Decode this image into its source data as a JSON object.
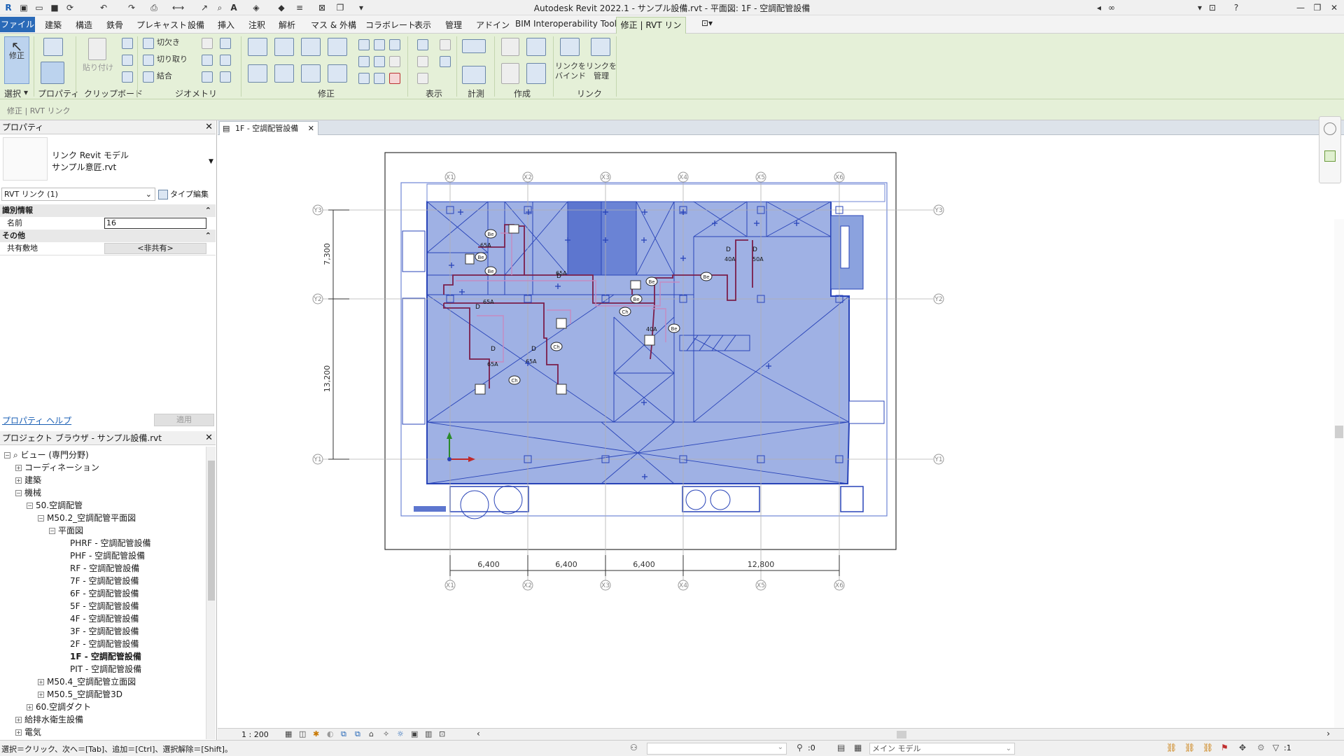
{
  "app": {
    "title": "Autodesk Revit 2022.1 - サンプル設備.rvt - 平面図: 1F - 空調配管設備"
  },
  "ribbon": {
    "file_tab": "ファイル",
    "tabs": [
      "建築",
      "構造",
      "鉄骨",
      "プレキャスト",
      "設備",
      "挿入",
      "注釈",
      "解析",
      "マス & 外構",
      "コラボレート",
      "表示",
      "管理",
      "アドイン",
      "BIM Interoperability Tools"
    ],
    "active_tab": "修正 | RVT リンク",
    "modify_label": "修正",
    "paste_label": "貼り付け",
    "cut_label": "切欠き",
    "split_label": "切り取り",
    "join_label": "結合",
    "properties_label": "プロパティ",
    "bind_link_label": "リンクを バインド",
    "manage_link_label": "リンクを 管理",
    "panels": {
      "select": "選択",
      "properties": "プロパティ",
      "clipboard": "クリップボード",
      "geometry": "ジオメトリ",
      "modify": "修正",
      "view": "表示",
      "measure": "計測",
      "create": "作成",
      "link": "リンク"
    }
  },
  "options_bar": {
    "context": "修正 | RVT リンク"
  },
  "properties": {
    "title": "プロパティ",
    "type_line1": "リンク Revit モデル",
    "type_line2": "サンプル意匠.rvt",
    "selector": "RVT リンク (1)",
    "edit_type": "タイプ編集",
    "group_identity": "識別情報",
    "name_label": "名前",
    "name_value": "16",
    "group_other": "その他",
    "shared_site_label": "共有敷地",
    "shared_site_value": "<非共有>",
    "help_link": "プロパティ ヘルプ",
    "apply": "適用"
  },
  "browser": {
    "title": "プロジェクト ブラウザ - サンプル設備.rvt",
    "items": [
      {
        "label": "ビュー (専門分野)",
        "depth": 0,
        "toggle": "−",
        "icon": true
      },
      {
        "label": "コーディネーション",
        "depth": 1,
        "toggle": "+"
      },
      {
        "label": "建築",
        "depth": 1,
        "toggle": "+"
      },
      {
        "label": "機械",
        "depth": 1,
        "toggle": "−"
      },
      {
        "label": "50.空調配管",
        "depth": 2,
        "toggle": "−"
      },
      {
        "label": "M50.2_空調配管平面図",
        "depth": 3,
        "toggle": "−"
      },
      {
        "label": "平面図",
        "depth": 4,
        "toggle": "−"
      },
      {
        "label": "PHRF - 空調配管設備",
        "depth": 5,
        "toggle": ""
      },
      {
        "label": "PHF - 空調配管設備",
        "depth": 5,
        "toggle": ""
      },
      {
        "label": "RF - 空調配管設備",
        "depth": 5,
        "toggle": ""
      },
      {
        "label": "7F - 空調配管設備",
        "depth": 5,
        "toggle": ""
      },
      {
        "label": "6F - 空調配管設備",
        "depth": 5,
        "toggle": ""
      },
      {
        "label": "5F - 空調配管設備",
        "depth": 5,
        "toggle": ""
      },
      {
        "label": "4F - 空調配管設備",
        "depth": 5,
        "toggle": ""
      },
      {
        "label": "3F - 空調配管設備",
        "depth": 5,
        "toggle": ""
      },
      {
        "label": "2F - 空調配管設備",
        "depth": 5,
        "toggle": ""
      },
      {
        "label": "1F - 空調配管設備",
        "depth": 5,
        "toggle": "",
        "bold": true
      },
      {
        "label": "PIT - 空調配管設備",
        "depth": 5,
        "toggle": ""
      },
      {
        "label": "M50.4_空調配管立面図",
        "depth": 3,
        "toggle": "+"
      },
      {
        "label": "M50.5_空調配管3D",
        "depth": 3,
        "toggle": "+"
      },
      {
        "label": "60.空調ダクト",
        "depth": 2,
        "toggle": "+"
      },
      {
        "label": "給排水衛生設備",
        "depth": 1,
        "toggle": "+"
      },
      {
        "label": "電気",
        "depth": 1,
        "toggle": "+"
      }
    ]
  },
  "view": {
    "tab_label": "1F - 空調配管設備",
    "scale": "1 : 200",
    "grids_x": [
      "X1",
      "X2",
      "X3",
      "X4",
      "X5",
      "X6"
    ],
    "grids_y": [
      "Y3",
      "Y2",
      "Y1"
    ],
    "dims_bottom": [
      "6,400",
      "6,400",
      "6,400",
      "12,800"
    ],
    "dims_left": [
      "7,300",
      "13,200"
    ],
    "pipe_labels": [
      "65A",
      "65A",
      "65A",
      "65A",
      "65A",
      "40A",
      "50A",
      "40A"
    ],
    "tag_be": "Be",
    "tag_ch": "Ch",
    "tag_d": "D"
  },
  "status": {
    "text": "選択＝クリック、次へ＝[Tab]、追加＝[Ctrl]、選択解除＝[Shift]。",
    "zero": ":0",
    "model": "メイン モデル",
    "filter": ":1"
  },
  "colors": {
    "accent": "#2a6ab8",
    "ribbon": "#e5f0d8",
    "fill": "#7b93d8",
    "line": "#2944b8",
    "pipe": "#7a1e4a"
  }
}
